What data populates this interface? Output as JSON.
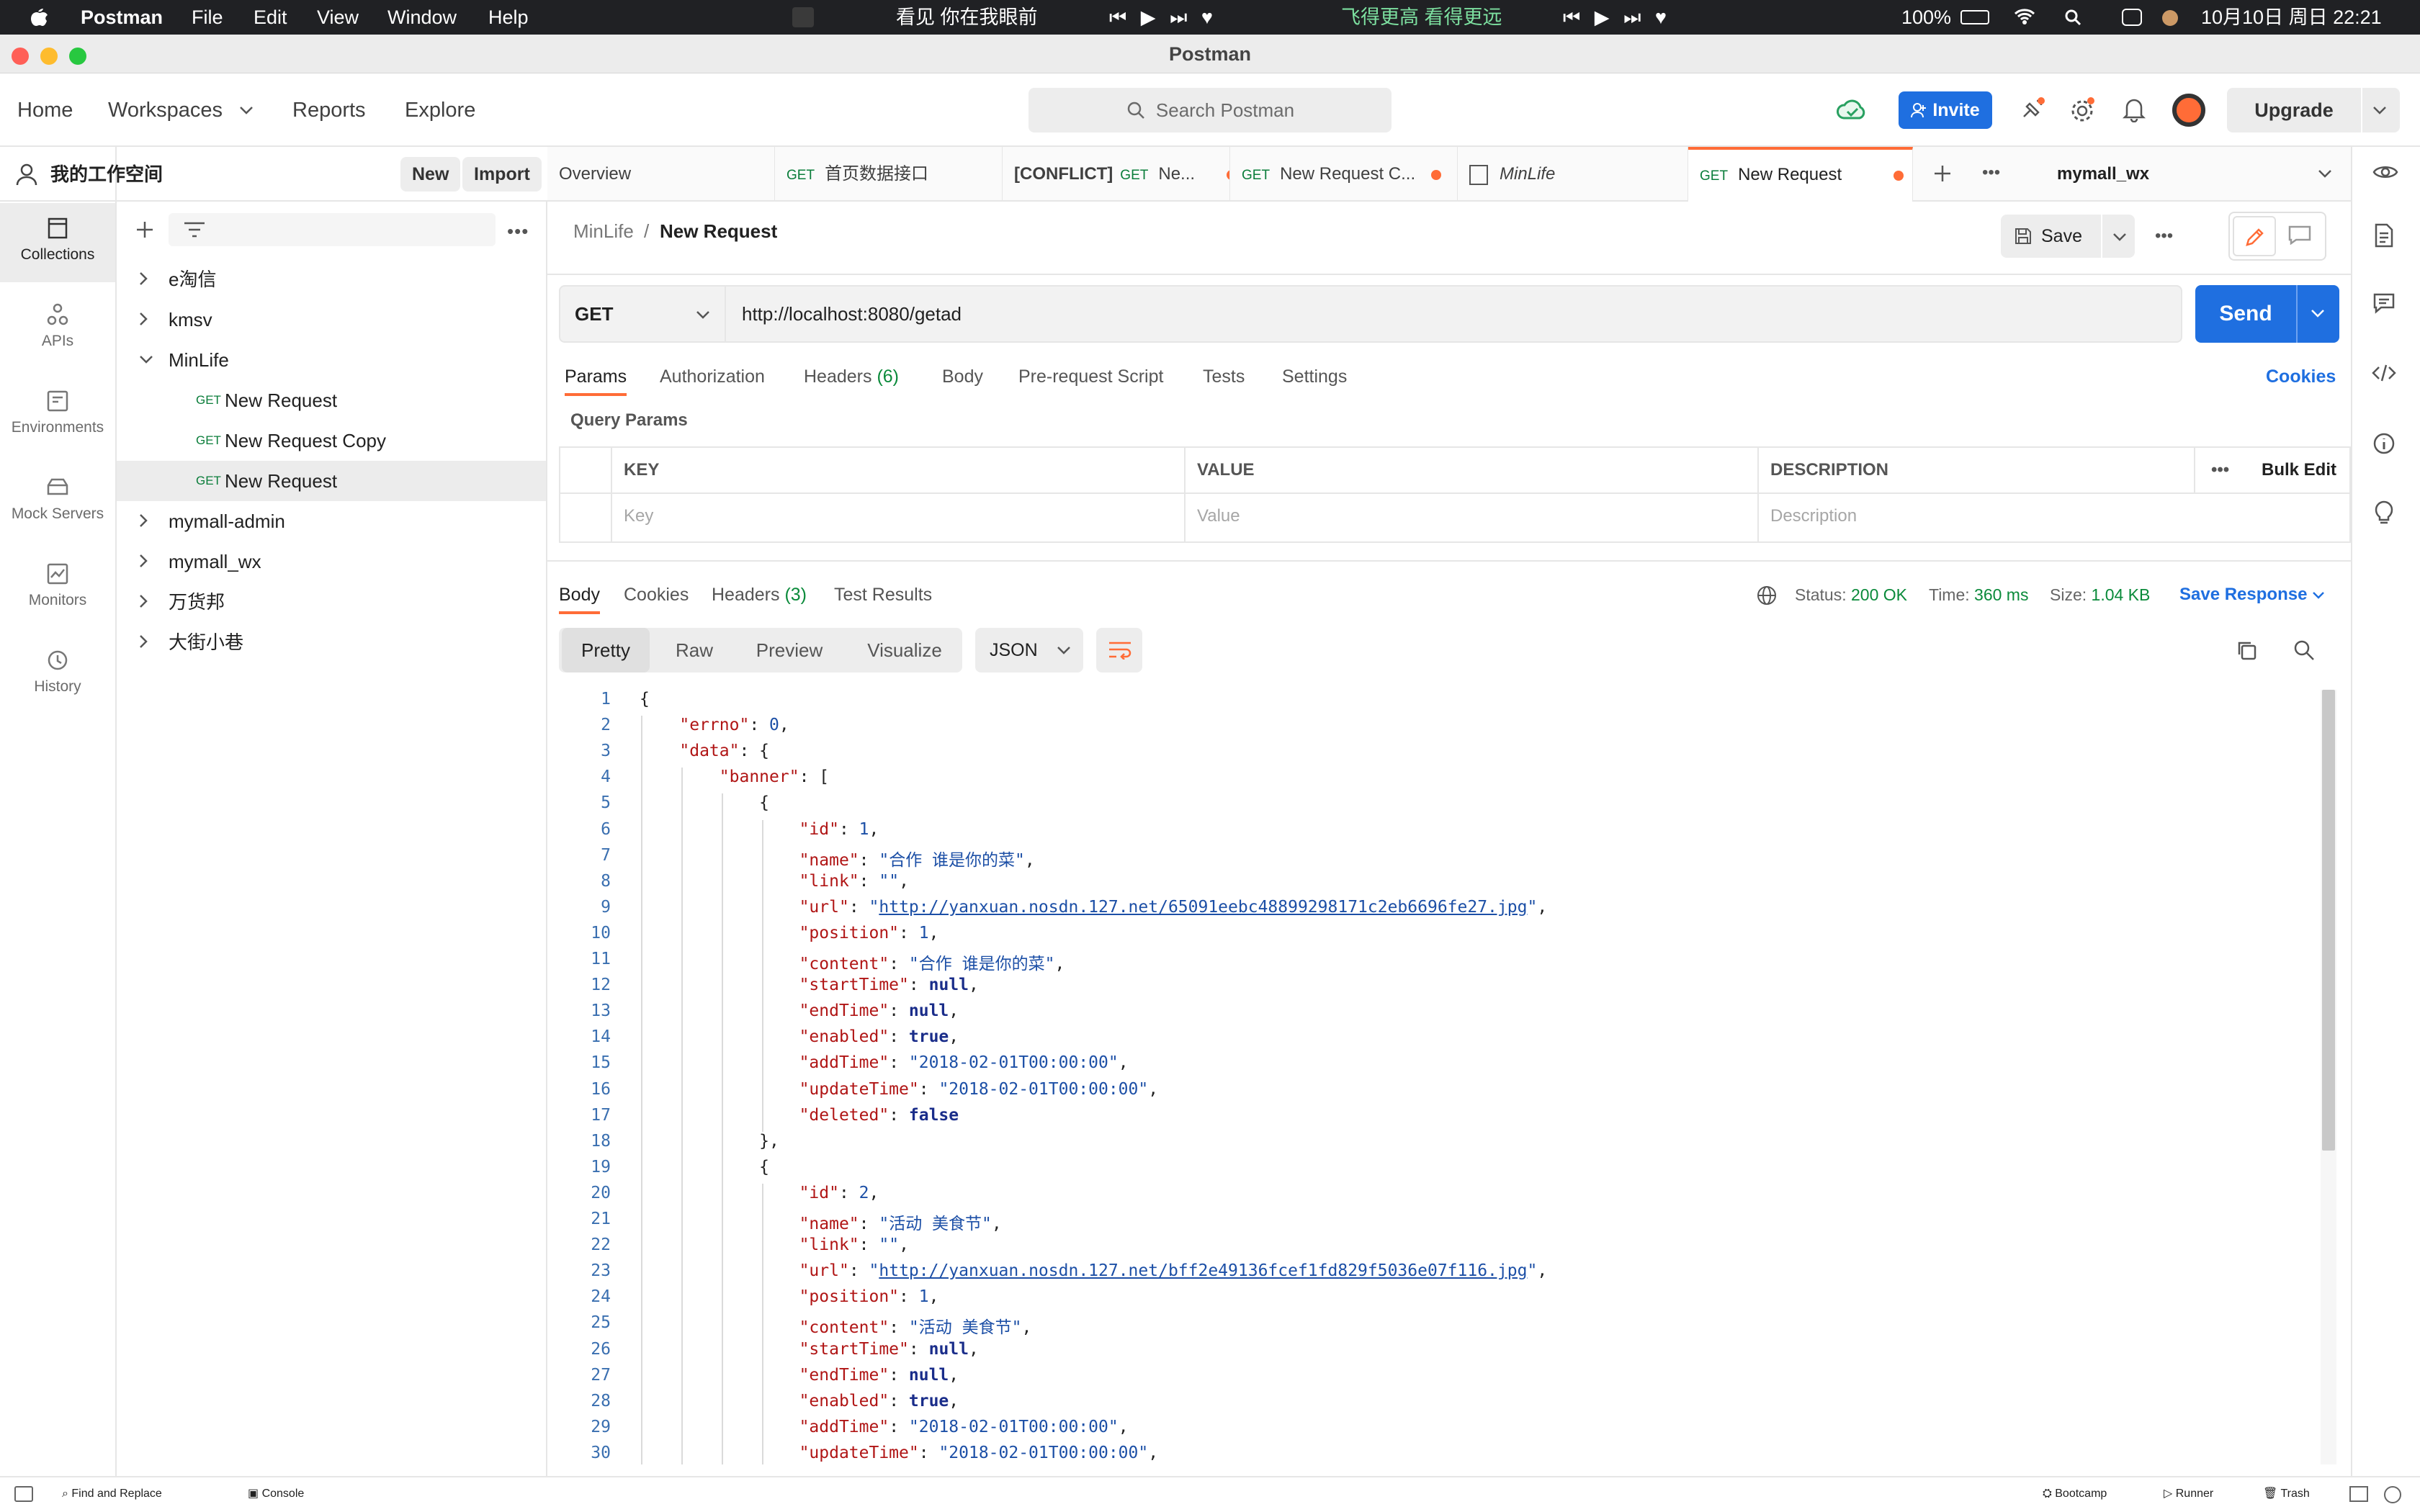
{
  "menubar": {
    "app": "Postman",
    "items": [
      "File",
      "Edit",
      "View",
      "Window",
      "Help"
    ],
    "song1": "看见 你在我眼前",
    "song2": "飞得更高 看得更远",
    "battery": "100%",
    "datetime": "10月10日 周日  22:21"
  },
  "window": {
    "title": "Postman"
  },
  "header": {
    "nav": [
      "Home",
      "Workspaces",
      "Reports",
      "Explore"
    ],
    "search_placeholder": "Search Postman",
    "invite": "Invite",
    "upgrade": "Upgrade"
  },
  "workspace": {
    "name": "我的工作空间",
    "new": "New",
    "import": "Import"
  },
  "rail": [
    "Collections",
    "APIs",
    "Environments",
    "Mock Servers",
    "Monitors",
    "History"
  ],
  "sidebar": {
    "method": "GET",
    "collections": [
      "e淘信",
      "kmsv",
      "MinLife",
      "mymall-admin",
      "mymall_wx",
      "万货邦",
      "大街小巷"
    ],
    "minlife_requests": [
      "New Request",
      "New Request Copy",
      "New Request"
    ]
  },
  "tabs": {
    "overview": "Overview",
    "t1": "首页数据接口",
    "t2_conflict": "[CONFLICT]",
    "t2": "Ne...",
    "t3": "New Request C...",
    "t4": "MinLife",
    "t5": "New Request",
    "environment": "mymall_wx"
  },
  "request": {
    "breadcrumb_parent": "MinLife",
    "breadcrumb_sep": "/",
    "name": "New Request",
    "save": "Save",
    "method": "GET",
    "url": "http://localhost:8080/getad",
    "send": "Send",
    "tabs": [
      "Params",
      "Authorization",
      "Headers",
      "(6)",
      "Body",
      "Pre-request Script",
      "Tests",
      "Settings"
    ],
    "cookies": "Cookies",
    "query_params_title": "Query Params",
    "columns": [
      "KEY",
      "VALUE",
      "DESCRIPTION"
    ],
    "bulk_edit": "Bulk Edit",
    "placeholders": [
      "Key",
      "Value",
      "Description"
    ]
  },
  "response": {
    "tabs": [
      "Body",
      "Cookies",
      "Headers",
      "(3)",
      "Test Results"
    ],
    "status_label": "Status:",
    "status": "200 OK",
    "time_label": "Time:",
    "time": "360 ms",
    "size_label": "Size:",
    "size": "1.04 KB",
    "save_response": "Save Response",
    "views": [
      "Pretty",
      "Raw",
      "Preview",
      "Visualize"
    ],
    "format": "JSON",
    "lines": [
      "{",
      "    \"errno\": 0,",
      "    \"data\": {",
      "        \"banner\": [",
      "            {",
      "                \"id\": 1,",
      "                \"name\": \"合作 谁是你的菜\",",
      "                \"link\": \"\",",
      "                \"url\": \"http://yanxuan.nosdn.127.net/65091eebc48899298171c2eb6696fe27.jpg\",",
      "                \"position\": 1,",
      "                \"content\": \"合作 谁是你的菜\",",
      "                \"startTime\": null,",
      "                \"endTime\": null,",
      "                \"enabled\": true,",
      "                \"addTime\": \"2018-02-01T00:00:00\",",
      "                \"updateTime\": \"2018-02-01T00:00:00\",",
      "                \"deleted\": false",
      "            },",
      "            {",
      "                \"id\": 2,",
      "                \"name\": \"活动 美食节\",",
      "                \"link\": \"\",",
      "                \"url\": \"http://yanxuan.nosdn.127.net/bff2e49136fcef1fd829f5036e07f116.jpg\",",
      "                \"position\": 1,",
      "                \"content\": \"活动 美食节\",",
      "                \"startTime\": null,",
      "                \"endTime\": null,",
      "                \"enabled\": true,",
      "                \"addTime\": \"2018-02-01T00:00:00\",",
      "                \"updateTime\": \"2018-02-01T00:00:00\","
    ]
  },
  "statusbar": {
    "find": "Find and Replace",
    "console": "Console",
    "bootcamp": "Bootcamp",
    "runner": "Runner",
    "trash": "Trash"
  },
  "colors": {
    "accent": "#ff6c37",
    "primary": "#1f6fe0",
    "ok": "#0a8a3a"
  },
  "icons": [
    "apple-icon",
    "search-icon",
    "cloud-sync-icon",
    "satellite-icon",
    "gear-icon",
    "bell-icon",
    "avatar-icon",
    "eye-icon",
    "plus-icon",
    "filter-icon",
    "more-icon",
    "chevron-right-icon",
    "chevron-down-icon",
    "pencil-icon",
    "comment-icon",
    "document-icon",
    "code-icon",
    "info-icon",
    "bulb-icon",
    "globe-icon",
    "copy-icon",
    "wrap-icon",
    "save-icon"
  ]
}
